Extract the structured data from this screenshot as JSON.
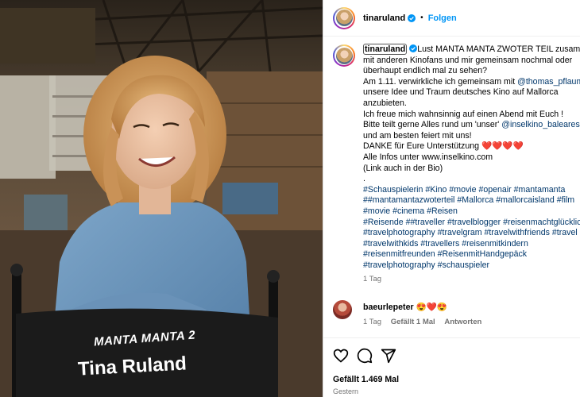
{
  "post": {
    "username": "tinaruland",
    "follow_label": "Folgen",
    "separator": "•"
  },
  "chair": {
    "logo_text": "MANTA MANTA 2",
    "name_text": "Tina Ruland"
  },
  "caption": {
    "username": "tinaruland",
    "lines": [
      {
        "segments": [
          {
            "t": "Lust MANTA MANTA ZWOTER TEIL zusammen",
            "k": "text"
          }
        ]
      },
      {
        "segments": [
          {
            "t": "mit anderen Kinofans und mir gemeinsam nochmal oder",
            "k": "text"
          }
        ]
      },
      {
        "segments": [
          {
            "t": "überhaupt endlich mal zu sehen?",
            "k": "text"
          }
        ]
      },
      {
        "segments": [
          {
            "t": "Am 1.11. verwirkliche ich gemeinsam mit ",
            "k": "text"
          },
          {
            "t": "@thomas_pflaum",
            "k": "mention"
          }
        ]
      },
      {
        "segments": [
          {
            "t": "unsere Idee und Traum deutsches Kino auf Mallorca",
            "k": "text"
          }
        ]
      },
      {
        "segments": [
          {
            "t": "anzubieten.",
            "k": "text"
          }
        ]
      },
      {
        "segments": [
          {
            "t": "Ich freue mich wahnsinnig auf einen Abend mit Euch !",
            "k": "text"
          }
        ]
      },
      {
        "segments": [
          {
            "t": "Bitte teilt gerne Alles rund um 'unser' ",
            "k": "text"
          },
          {
            "t": "@inselkino_baleares",
            "k": "mention"
          }
        ]
      },
      {
        "segments": [
          {
            "t": "und am besten feiert mit uns!",
            "k": "text"
          }
        ]
      },
      {
        "segments": [
          {
            "t": "DANKE für Eure Unterstützung ",
            "k": "text"
          },
          {
            "t": "❤️❤️❤️❤️",
            "k": "hearts"
          }
        ]
      },
      {
        "segments": [
          {
            "t": "Alle Infos unter www.inselkino.com",
            "k": "text"
          }
        ]
      },
      {
        "segments": [
          {
            "t": "(Link auch in der Bio)",
            "k": "text"
          }
        ]
      },
      {
        "segments": [
          {
            "t": ".",
            "k": "text"
          }
        ]
      },
      {
        "segments": [
          {
            "t": "#Schauspielerin #Kino #movie #openair #mantamanta",
            "k": "tag"
          }
        ]
      },
      {
        "segments": [
          {
            "t": "##mantamantazwoterteil #Mallorca #mallorcaisland #film",
            "k": "tag"
          }
        ]
      },
      {
        "segments": [
          {
            "t": "#movie #cinema #Reisen",
            "k": "tag"
          }
        ]
      },
      {
        "segments": [
          {
            "t": "#Reisende ##traveller #travelblogger #reisenmachtglücklich",
            "k": "tag"
          }
        ]
      },
      {
        "segments": [
          {
            "t": "#travelphotography #travelgram #travelwithfriends #travel",
            "k": "tag"
          }
        ]
      },
      {
        "segments": [
          {
            "t": "#travelwithkids #travellers #reisenmitkindern",
            "k": "tag"
          }
        ]
      },
      {
        "segments": [
          {
            "t": "#reisenmitfreunden #ReisenmitHandgepäck",
            "k": "tag"
          }
        ]
      },
      {
        "segments": [
          {
            "t": "#travelphotography #schauspieler",
            "k": "tag"
          }
        ]
      }
    ],
    "time": "1 Tag"
  },
  "comment": {
    "username": "baeurlepeter",
    "text": "😍❤️😍",
    "time": "1 Tag",
    "likes": "Gefällt 1 Mal",
    "reply": "Antworten"
  },
  "actions": {
    "like_icon": "heart-outline-icon",
    "comment_icon": "speech-bubble-icon",
    "share_icon": "paper-plane-icon",
    "likes_label": "Gefällt 1.469 Mal",
    "date_label": "Gestern"
  },
  "colors": {
    "link": "#00376b",
    "follow": "#0095f6",
    "muted": "#737373",
    "verified": "#0095f6"
  }
}
